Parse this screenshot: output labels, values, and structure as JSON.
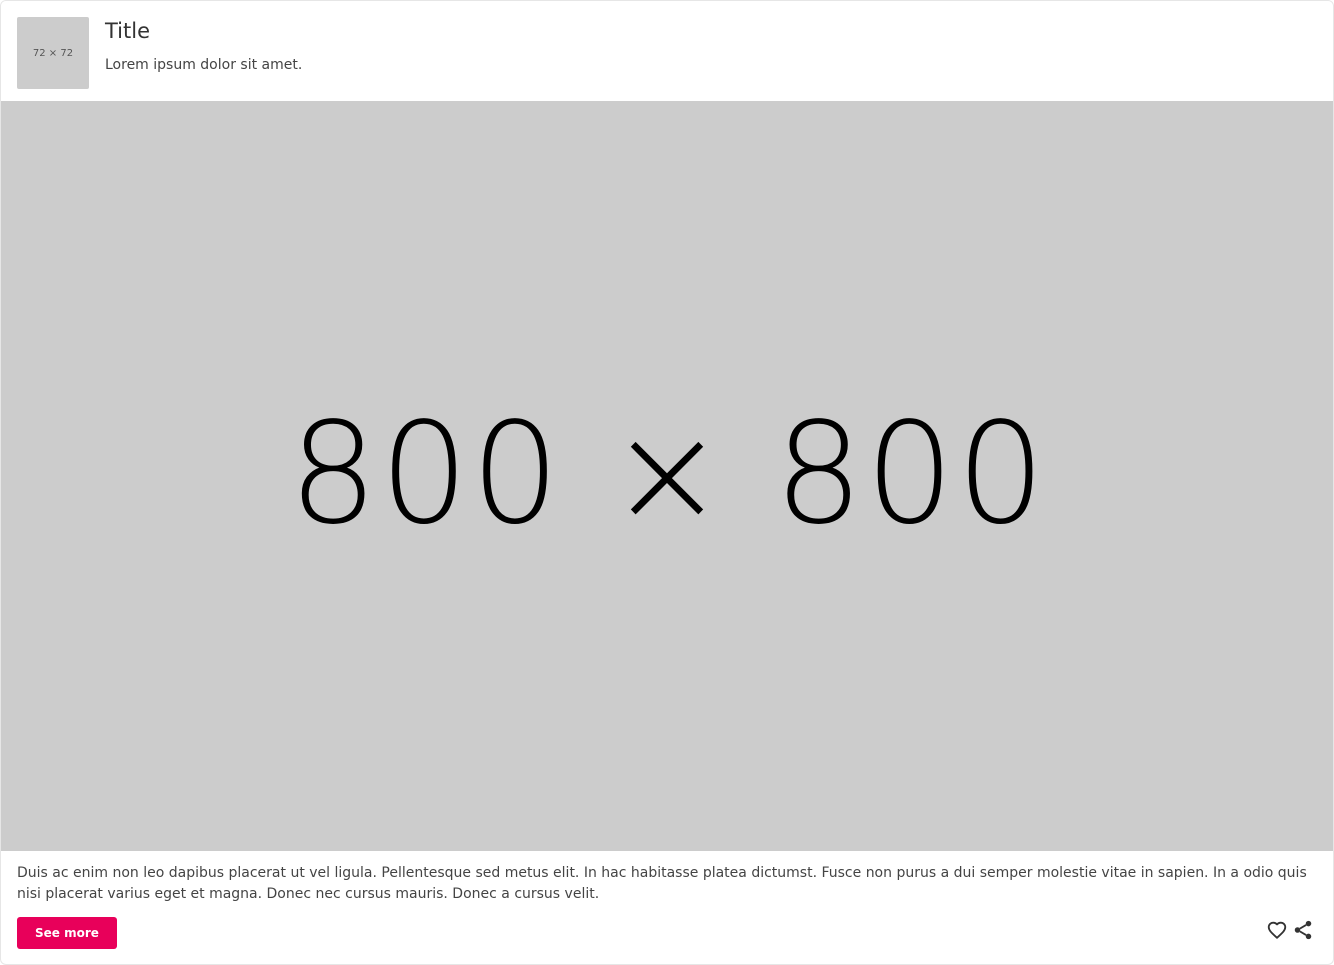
{
  "header": {
    "avatar_label": "72 × 72",
    "title": "Title",
    "subtitle": "Lorem ipsum dolor sit amet."
  },
  "media": {
    "label": "800 × 800",
    "background": "#cccccc"
  },
  "body": {
    "text": "Duis ac enim non leo dapibus placerat ut vel ligula. Pellentesque sed metus elit. In hac habitasse platea dictumst. Fusce non purus a dui semper molestie vitae in sapien. In a odio quis nisi placerat varius eget et magna. Donec nec cursus mauris. Donec a cursus velit."
  },
  "actions": {
    "see_more_label": "See more",
    "accent_color": "#e8005a",
    "icons": [
      "heart-icon",
      "share-icon"
    ]
  }
}
